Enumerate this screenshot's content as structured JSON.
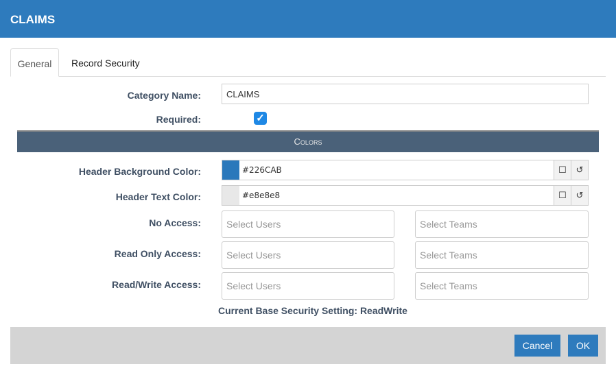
{
  "header": {
    "title": "CLAIMS",
    "color": "#2e7bbd"
  },
  "tabs": [
    {
      "label": "General",
      "active": true
    },
    {
      "label": "Record Security",
      "active": false
    }
  ],
  "form": {
    "category_name_label": "Category Name:",
    "category_name_value": "CLAIMS",
    "required_label": "Required:",
    "required_checked": true,
    "colors_heading": "Colors",
    "header_bg_label": "Header Background Color:",
    "header_bg_value": "#226CAB",
    "header_bg_swatch": "#2a78bb",
    "header_text_label": "Header Text Color:",
    "header_text_value": "#e8e8e8",
    "header_text_swatch": "#e8e8e8",
    "access": [
      {
        "label": "No Access:",
        "users_placeholder": "Select Users",
        "teams_placeholder": "Select Teams"
      },
      {
        "label": "Read Only Access:",
        "users_placeholder": "Select Users",
        "teams_placeholder": "Select Teams"
      },
      {
        "label": "Read/Write Access:",
        "users_placeholder": "Select Users",
        "teams_placeholder": "Select Teams"
      }
    ],
    "base_security": "Current Base Security Setting: ReadWrite"
  },
  "footer": {
    "cancel": "Cancel",
    "ok": "OK"
  }
}
